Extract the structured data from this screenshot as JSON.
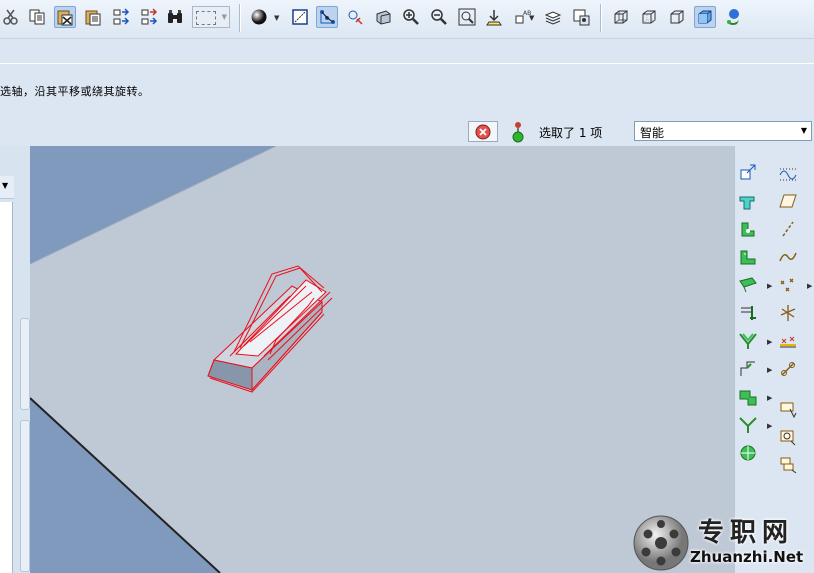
{
  "toolbar": {
    "icons": [
      "cut-icon",
      "copy-icon",
      "paste-icon",
      "paste-special-icon",
      "regenerate-icon",
      "regen-manager-icon",
      "find-icon",
      "select-box-icon",
      "shading-icon",
      "orient-icon",
      "datum-display-icon",
      "spin-center-icon",
      "view-manager-icon",
      "zoom-in-icon",
      "zoom-out-icon",
      "refit-icon",
      "repaint-icon",
      "annotation-display-icon",
      "layers-icon",
      "saved-views-icon",
      "wireframe-icon",
      "hidden-line-icon",
      "no-hidden-icon",
      "shaded-icon",
      "help-icon"
    ]
  },
  "message": {
    "text": "选轴，沿其平移或绕其旋转。"
  },
  "status": {
    "selected_text": "选取了 1 项",
    "filter_value": "智能"
  },
  "colors": {
    "background": "#dce6f2",
    "viewport_plane": "#bfc8d5",
    "viewport_bg": "#7f9abd",
    "selection": "#e8101b"
  },
  "right_toolbar": {
    "icons": [
      "plane-icon",
      "sketch-icon",
      "extrude-icon",
      "datum-plane-icon",
      "revolve-icon",
      "datum-axis-icon",
      "sweep-icon",
      "datum-curve-icon",
      "blend-icon",
      "datum-point-icon",
      "hole-icon",
      "csys-icon",
      "round-icon",
      "analysis-icon",
      "chamfer-icon",
      "chain-icon",
      "draft-icon",
      "insert-icon",
      "shell-icon",
      "sketch-region-icon",
      "rib-icon",
      "pattern-icon",
      "mirror-icon"
    ]
  },
  "watermark": {
    "cn": "专职网",
    "en": "Zhuanzhi.Net"
  }
}
